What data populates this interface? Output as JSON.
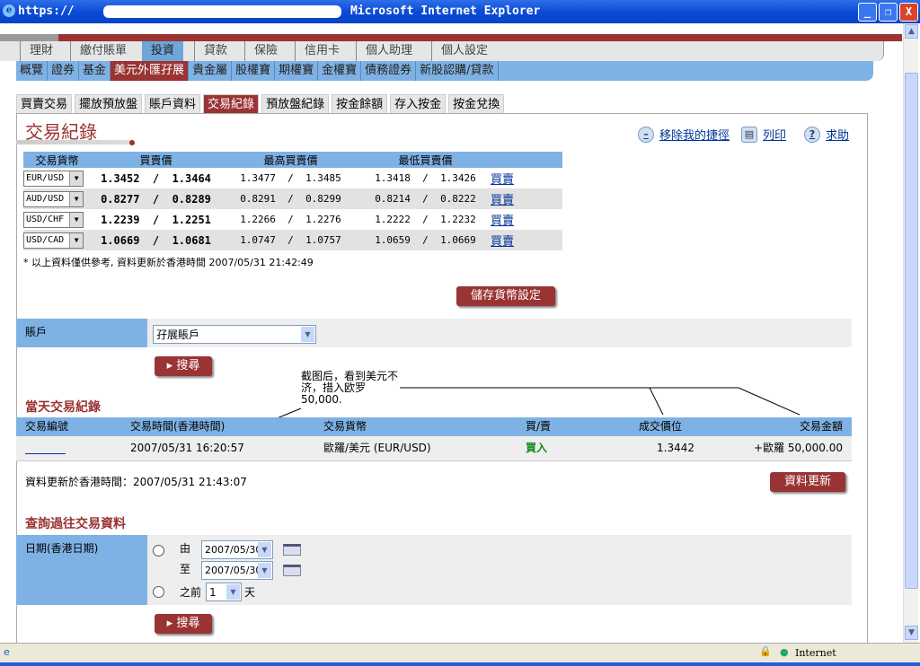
{
  "window": {
    "title_prefix": "https://",
    "title_suffix": "Microsoft Internet Explorer",
    "min": "_",
    "max": "❐",
    "close": "X"
  },
  "main_nav": [
    {
      "label": "理財"
    },
    {
      "label": "繳付賬單"
    },
    {
      "label": "投資",
      "active": true
    },
    {
      "label": "貸款"
    },
    {
      "label": "保險"
    },
    {
      "label": "信用卡"
    },
    {
      "label": "個人助理"
    },
    {
      "label": "個人設定"
    }
  ],
  "sub_nav": [
    {
      "label": "概覽"
    },
    {
      "label": "證券"
    },
    {
      "label": "基金"
    },
    {
      "label": "美元外匯孖展",
      "active": true
    },
    {
      "label": "貴金屬"
    },
    {
      "label": "股權寶"
    },
    {
      "label": "期權寶"
    },
    {
      "label": "金權寶"
    },
    {
      "label": "債務證券"
    },
    {
      "label": "新股認購/貸款"
    }
  ],
  "tabs": [
    {
      "label": "買賣交易"
    },
    {
      "label": "擺放預放盤"
    },
    {
      "label": "賬戶資料"
    },
    {
      "label": "交易紀錄",
      "active": true
    },
    {
      "label": "預放盤紀錄"
    },
    {
      "label": "按金餘額"
    },
    {
      "label": "存入按金"
    },
    {
      "label": "按金兌換"
    }
  ],
  "page_title": "交易紀錄",
  "top_links": {
    "remove_shortcut": "移除我的捷徑",
    "print": "列印",
    "help": "求助"
  },
  "fx_table": {
    "headers": [
      "交易貨幣",
      "買賣價",
      "最高買賣價",
      "最低買賣價"
    ],
    "rows": [
      {
        "pair": "EUR/USD",
        "bid": "1.3452",
        "ask": "1.3464",
        "high_bid": "1.3477",
        "high_ask": "1.3485",
        "low_bid": "1.3418",
        "low_ask": "1.3426",
        "action": "買賣"
      },
      {
        "pair": "AUD/USD",
        "bid": "0.8277",
        "ask": "0.8289",
        "high_bid": "0.8291",
        "high_ask": "0.8299",
        "low_bid": "0.8214",
        "low_ask": "0.8222",
        "action": "買賣"
      },
      {
        "pair": "USD/CHF",
        "bid": "1.2239",
        "ask": "1.2251",
        "high_bid": "1.2266",
        "high_ask": "1.2276",
        "low_bid": "1.2222",
        "low_ask": "1.2232",
        "action": "買賣"
      },
      {
        "pair": "USD/CAD",
        "bid": "1.0669",
        "ask": "1.0681",
        "high_bid": "1.0747",
        "high_ask": "1.0757",
        "low_bid": "1.0659",
        "low_ask": "1.0669",
        "action": "買賣"
      }
    ],
    "note": "* 以上資料僅供參考, 資料更新於香港時間 2007/05/31 21:42:49"
  },
  "save_currency_btn": "儲存貨幣設定",
  "account": {
    "label": "賬戶",
    "value": "孖展賬戶"
  },
  "search_btn": "搜尋",
  "today": {
    "title": "當天交易紀錄",
    "headers": [
      "交易編號",
      "交易時間(香港時間)",
      "交易貨幣",
      "買/賣",
      "成交價位",
      "交易金額"
    ],
    "row": {
      "time": "2007/05/31 16:20:57",
      "currency": "歐羅/美元 (EUR/USD)",
      "side": "買入",
      "price": "1.3442",
      "amount": "+歐羅 50,000.00"
    },
    "update_note": "資料更新於香港時間：2007/05/31 21:43:07",
    "refresh_btn": "資料更新"
  },
  "annotation": "截图后，看到美元不济，措入欧罗50,000.",
  "history": {
    "title": "查詢過往交易資料",
    "label": "日期(香港日期)",
    "from": "由",
    "from_value": "2007/05/30",
    "to": "至",
    "to_value": "2007/05/30",
    "before": "之前",
    "before_value": "1",
    "days": "天"
  },
  "status": {
    "zone": "Internet"
  },
  "colors": {
    "accent": "#9a3333",
    "nav_blue": "#7fb2e4",
    "buy_green": "#118811"
  }
}
